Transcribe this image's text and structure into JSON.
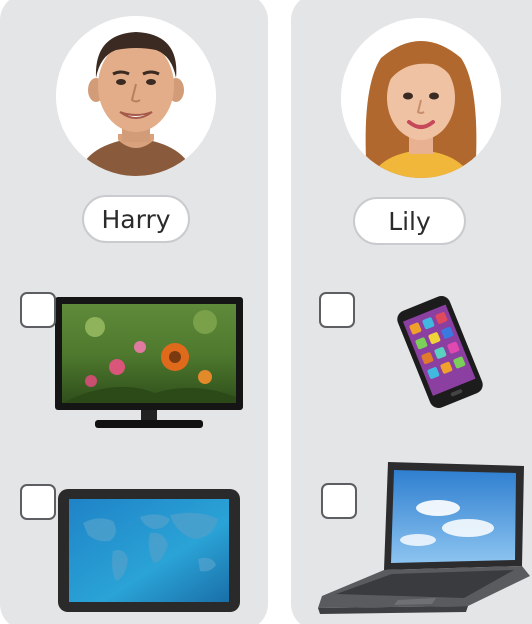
{
  "people": [
    {
      "name": "Harry",
      "devices": [
        {
          "icon": "television-icon",
          "checked": false
        },
        {
          "icon": "tablet-icon",
          "checked": false
        }
      ]
    },
    {
      "name": "Lily",
      "devices": [
        {
          "icon": "smartphone-icon",
          "checked": false
        },
        {
          "icon": "laptop-icon",
          "checked": false
        }
      ]
    }
  ],
  "colors": {
    "panel": "#e4e5e7",
    "pill_border": "#c9cbce",
    "checkbox_border": "#5c5e62"
  }
}
